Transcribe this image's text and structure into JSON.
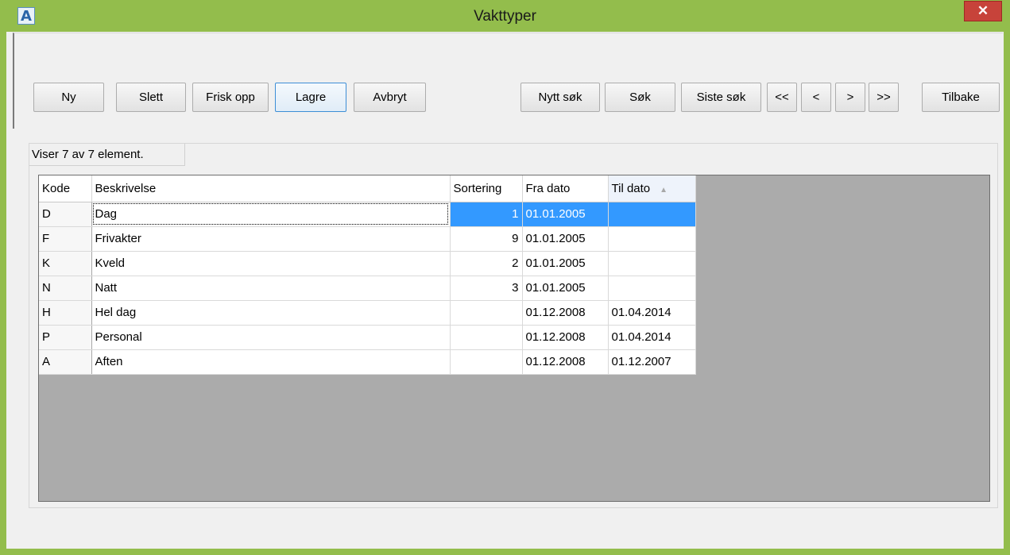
{
  "window": {
    "title": "Vakttyper",
    "app_icon": "A",
    "close_label": "✕"
  },
  "toolbar": {
    "ny": "Ny",
    "slett": "Slett",
    "frisk_opp": "Frisk opp",
    "lagre": "Lagre",
    "avbryt": "Avbryt",
    "nytt_sok": "Nytt søk",
    "sok": "Søk",
    "siste_sok": "Siste søk",
    "first": "<<",
    "prev": "<",
    "next": ">",
    "last": ">>",
    "tilbake": "Tilbake"
  },
  "status": "Viser 7 av 7 element.",
  "grid": {
    "columns": [
      "Kode",
      "Beskrivelse",
      "Sortering",
      "Fra dato",
      "Til dato"
    ],
    "sort_column": "Til dato",
    "rows": [
      {
        "kode": "D",
        "beskrivelse": "Dag",
        "sortering": "1",
        "fra": "01.01.2005",
        "til": ""
      },
      {
        "kode": "F",
        "beskrivelse": "Frivakter",
        "sortering": "9",
        "fra": "01.01.2005",
        "til": ""
      },
      {
        "kode": "K",
        "beskrivelse": "Kveld",
        "sortering": "2",
        "fra": "01.01.2005",
        "til": ""
      },
      {
        "kode": "N",
        "beskrivelse": "Natt",
        "sortering": "3",
        "fra": "01.01.2005",
        "til": ""
      },
      {
        "kode": "H",
        "beskrivelse": "Hel dag",
        "sortering": "",
        "fra": "01.12.2008",
        "til": "01.04.2014"
      },
      {
        "kode": "P",
        "beskrivelse": "Personal",
        "sortering": "",
        "fra": "01.12.2008",
        "til": "01.04.2014"
      },
      {
        "kode": "A",
        "beskrivelse": "Aften",
        "sortering": "",
        "fra": "01.12.2008",
        "til": "01.12.2007"
      }
    ]
  },
  "colors": {
    "titlebar": "#93bd4c",
    "close": "#c7433a",
    "selection": "#3399ff",
    "grid_bg": "#ababab"
  }
}
